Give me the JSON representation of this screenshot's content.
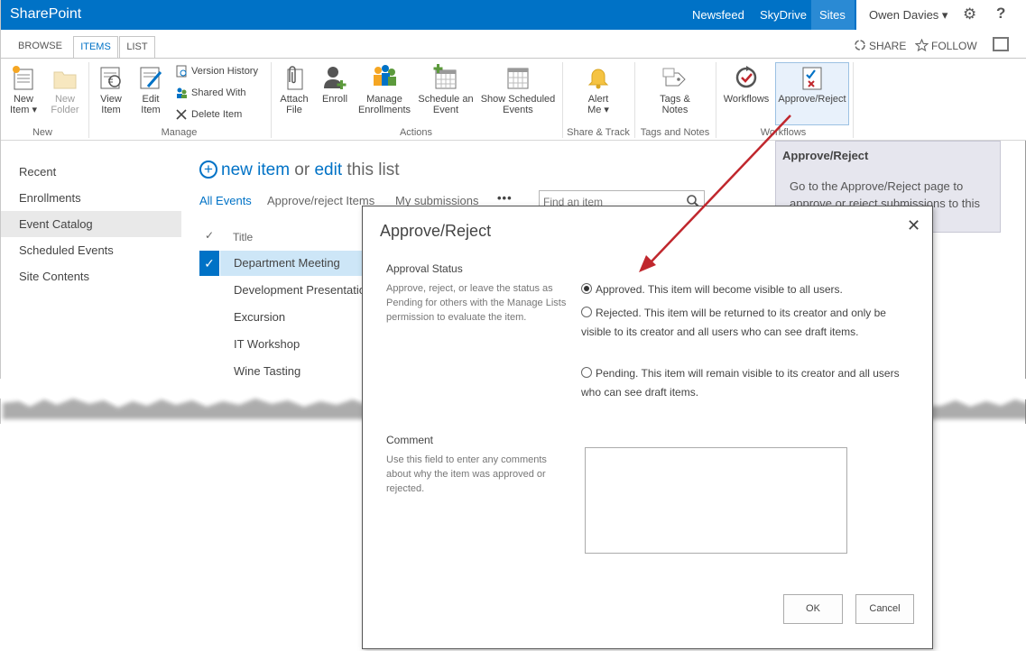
{
  "suite_bar": {
    "brand": "SharePoint",
    "nav": [
      "Newsfeed",
      "SkyDrive",
      "Sites"
    ],
    "user": "Owen Davies ▾",
    "settings_icon": "gear-icon",
    "help_icon": "help-icon"
  },
  "ribbon_tabs": {
    "tabs": [
      "BROWSE",
      "ITEMS",
      "LIST"
    ],
    "active": "ITEMS",
    "share": "SHARE",
    "follow": "FOLLOW"
  },
  "ribbon": {
    "groups": [
      "New",
      "Manage",
      "Actions",
      "Share & Track",
      "Tags and Notes",
      "Workflows"
    ],
    "buttons": {
      "new_item": [
        "New",
        "Item ▾"
      ],
      "new_folder": [
        "New",
        "Folder"
      ],
      "view_item": [
        "View",
        "Item"
      ],
      "edit_item": [
        "Edit",
        "Item"
      ],
      "version_history": "Version History",
      "shared_with": "Shared With",
      "delete_item": "Delete Item",
      "attach_file": [
        "Attach",
        "File"
      ],
      "enroll": "Enroll",
      "manage_enrollments": [
        "Manage",
        "Enrollments"
      ],
      "schedule_event": [
        "Schedule an",
        "Event"
      ],
      "show_scheduled_events": [
        "Show Scheduled",
        "Events"
      ],
      "alert_me": [
        "Alert",
        "Me ▾"
      ],
      "tags_notes": [
        "Tags &",
        "Notes"
      ],
      "workflows": "Workflows",
      "approve_reject": "Approve/Reject"
    }
  },
  "tooltip": {
    "title": "Approve/Reject",
    "body": "Go to the Approve/Reject page to approve or reject submissions to this"
  },
  "left_nav": {
    "items": [
      "Recent",
      "Enrollments",
      "Event Catalog",
      "Scheduled Events",
      "Site Contents"
    ],
    "selected": "Event Catalog"
  },
  "list": {
    "new_item": "new item",
    "or": " or ",
    "edit": "edit",
    "this_list": " this list",
    "views": [
      "All Events",
      "Approve/reject Items",
      "My submissions"
    ],
    "more": "•••",
    "search_placeholder": "Find an item",
    "column_check": "✓",
    "column_title": "Title",
    "rows": [
      "Department Meeting",
      "Development Presentation",
      "Excursion",
      "IT Workshop",
      "Wine Tasting"
    ],
    "selected_row": "Department Meeting"
  },
  "dialog": {
    "title": "Approve/Reject",
    "close": "✕",
    "approval_status": {
      "label": "Approval Status",
      "description": "Approve, reject, or leave the status as Pending for others with the Manage Lists permission to evaluate the item.",
      "options": [
        {
          "text": "Approved. This item will become visible to all users.",
          "checked": true
        },
        {
          "text": "Rejected. This item will be returned to its creator and only be visible to its creator and all users who can see draft items.",
          "checked": false
        },
        {
          "text": "Pending. This item will remain visible to its creator and all users who can see draft items.",
          "checked": false
        }
      ]
    },
    "comment": {
      "label": "Comment",
      "description": "Use this field to enter any comments about why the item was approved or rejected.",
      "value": ""
    },
    "ok": "OK",
    "cancel": "Cancel"
  },
  "colors": {
    "suite_bar": "#0072c6",
    "accent": "#0072c6",
    "arrow": "#c0272d"
  }
}
